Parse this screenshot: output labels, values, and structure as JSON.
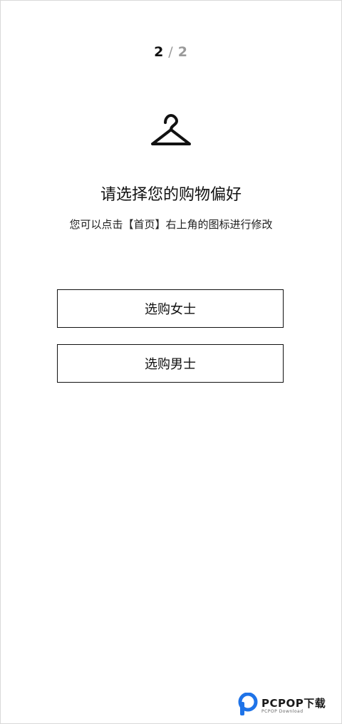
{
  "step": {
    "current": "2",
    "separator": "/",
    "total": "2"
  },
  "icon": {
    "name": "hanger-icon"
  },
  "title": "请选择您的购物偏好",
  "subtitle": "您可以点击【首页】右上角的图标进行修改",
  "options": {
    "women": "选购女士",
    "men": "选购男士"
  },
  "watermark": {
    "brand": "PCPOP下载",
    "sub": "PCPOP Download"
  },
  "colors": {
    "text": "#111111",
    "muted": "#9a9a9a",
    "border": "#111111",
    "background": "#ffffff",
    "watermark_accent": "#1e73e8"
  }
}
